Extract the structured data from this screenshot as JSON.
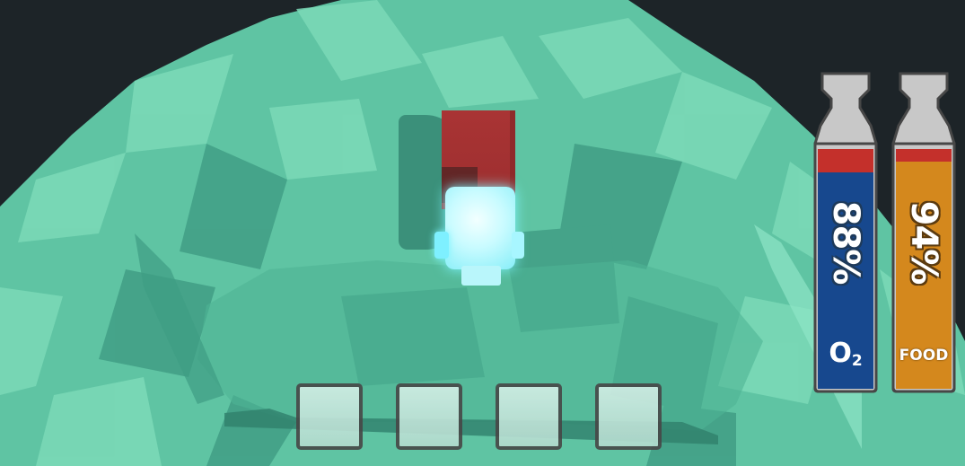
{
  "hud": {
    "oxygen": {
      "percent_label": "88%",
      "level": 0.88,
      "label": "O",
      "label_sub": "2",
      "color": "#17488e"
    },
    "food": {
      "percent_label": "94%",
      "level": 0.94,
      "label": "FOOD",
      "color": "#d4881d"
    }
  },
  "inventory": {
    "slots": [
      {
        "item": ""
      },
      {
        "item": ""
      },
      {
        "item": ""
      },
      {
        "item": ""
      }
    ]
  },
  "colors": {
    "background": "#1d2428",
    "asteroid": "#5fc4a3",
    "backpack": "#a93434",
    "helmet_glow": "#7ef5ff",
    "gauge_frame": "#474747",
    "gauge_cap": "#c8c8c8",
    "gauge_warning": "#c4302b"
  }
}
